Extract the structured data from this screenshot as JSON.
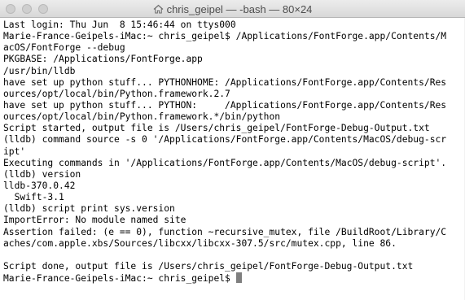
{
  "window": {
    "title": "chris_geipel — -bash — 80×24",
    "home_icon": "home-icon"
  },
  "terminal": {
    "lines": [
      "Last login: Thu Jun  8 15:46:44 on ttys000",
      "Marie-France-Geipels-iMac:~ chris_geipel$ /Applications/FontForge.app/Contents/M",
      "acOS/FontForge --debug",
      "PKGBASE: /Applications/FontForge.app",
      "/usr/bin/lldb",
      "have set up python stuff... PYTHONHOME: /Applications/FontForge.app/Contents/Res",
      "ources/opt/local/bin/Python.framework.2.7",
      "have set up python stuff... PYTHON:     /Applications/FontForge.app/Contents/Res",
      "ources/opt/local/bin/Python.framework.*/bin/python",
      "Script started, output file is /Users/chris_geipel/FontForge-Debug-Output.txt",
      "(lldb) command source -s 0 '/Applications/FontForge.app/Contents/MacOS/debug-scr",
      "ipt'",
      "Executing commands in '/Applications/FontForge.app/Contents/MacOS/debug-script'.",
      "(lldb) version",
      "lldb-370.0.42",
      "  Swift-3.1",
      "(lldb) script print sys.version",
      "ImportError: No module named site",
      "Assertion failed: (e == 0), function ~recursive_mutex, file /BuildRoot/Library/C",
      "aches/com.apple.xbs/Sources/libcxx/libcxx-307.5/src/mutex.cpp, line 86.",
      "",
      "Script done, output file is /Users/chris_geipel/FontForge-Debug-Output.txt"
    ],
    "prompt": "Marie-France-Geipels-iMac:~ chris_geipel$ "
  }
}
